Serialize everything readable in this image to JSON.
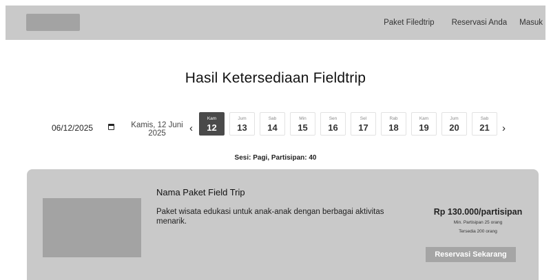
{
  "header": {
    "nav": [
      "Paket Filedtrip",
      "Reservasi Anda",
      "Masuk"
    ]
  },
  "page_title": "Hasil Ketersediaan Fieldtrip",
  "date_picker": {
    "value": "06/12/2025",
    "icon": "calendar-icon",
    "selected_label": "Kamis, 12 Juni 2025",
    "prev_icon": "‹",
    "next_icon": "›",
    "days": [
      {
        "name": "Kam",
        "date": "12",
        "active": true
      },
      {
        "name": "Jum",
        "date": "13",
        "active": false
      },
      {
        "name": "Sab",
        "date": "14",
        "active": false
      },
      {
        "name": "Min",
        "date": "15",
        "active": false
      },
      {
        "name": "Sen",
        "date": "16",
        "active": false
      },
      {
        "name": "Sel",
        "date": "17",
        "active": false
      },
      {
        "name": "Rab",
        "date": "18",
        "active": false
      },
      {
        "name": "Kam",
        "date": "19",
        "active": false
      },
      {
        "name": "Jum",
        "date": "20",
        "active": false
      },
      {
        "name": "Sab",
        "date": "21",
        "active": false
      }
    ]
  },
  "session_info": "Sesi: Pagi, Partisipan: 40",
  "package": {
    "name": "Nama Paket Field Trip",
    "description": "Paket wisata edukasi untuk anak-anak dengan berbagai aktivitas menarik.",
    "price": "Rp 130.000/partisipan",
    "min_participants": "Min. Partisipan 25 orang",
    "available": "Tersedia 200 orang",
    "button_label": "Reservasi Sekarang"
  },
  "colors": {
    "header_bg": "#c9c9c9",
    "placeholder_bg": "#a3a3a3",
    "active_day_bg": "#4a4a4a",
    "button_bg": "#a5a5a5"
  }
}
